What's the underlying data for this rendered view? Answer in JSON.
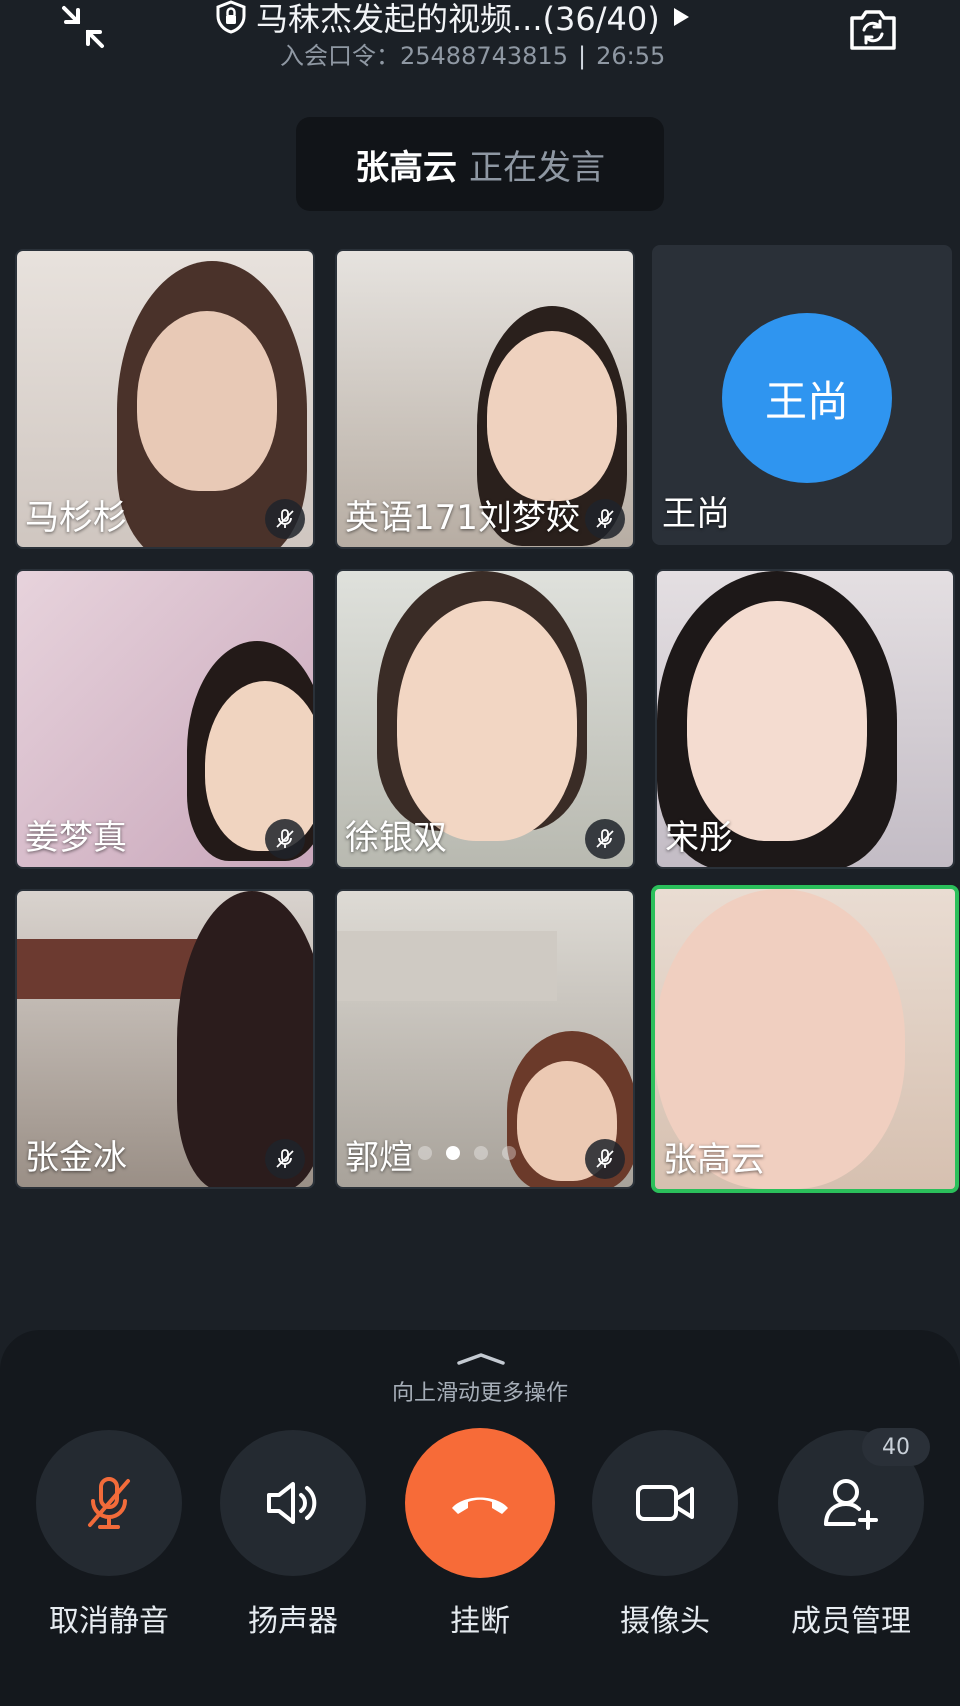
{
  "header": {
    "title": "马秣杰发起的视频...(36/40)",
    "join_code_label": "入会口令：25488743815",
    "separator": "|",
    "elapsed": "26:55"
  },
  "speaking": {
    "name": "张高云",
    "status": "正在发言"
  },
  "participants": [
    {
      "name": "马杉杉",
      "muted": true
    },
    {
      "name": "英语171刘梦姣",
      "muted": true
    },
    {
      "name": "王尚",
      "avatar_text": "王尚",
      "muted": false,
      "video": false
    },
    {
      "name": "姜梦真",
      "muted": true
    },
    {
      "name": "徐银双",
      "muted": true
    },
    {
      "name": "宋彤",
      "muted": false
    },
    {
      "name": "张金冰",
      "muted": true
    },
    {
      "name": "郭煊",
      "muted": true
    },
    {
      "name": "张高云",
      "muted": false,
      "active_speaker": true
    }
  ],
  "pager": {
    "page": 2,
    "pages": 4
  },
  "controls": {
    "hint": "向上滑动更多操作",
    "unmute": "取消静音",
    "speaker": "扬声器",
    "hangup": "挂断",
    "camera": "摄像头",
    "members": "成员管理",
    "members_count": "40"
  },
  "colors": {
    "background": "#1b2026",
    "hangup": "#f76b38",
    "avatar": "#2f95f0",
    "active_border": "#2bbf5b",
    "muted_icon": "#f26b3a"
  }
}
